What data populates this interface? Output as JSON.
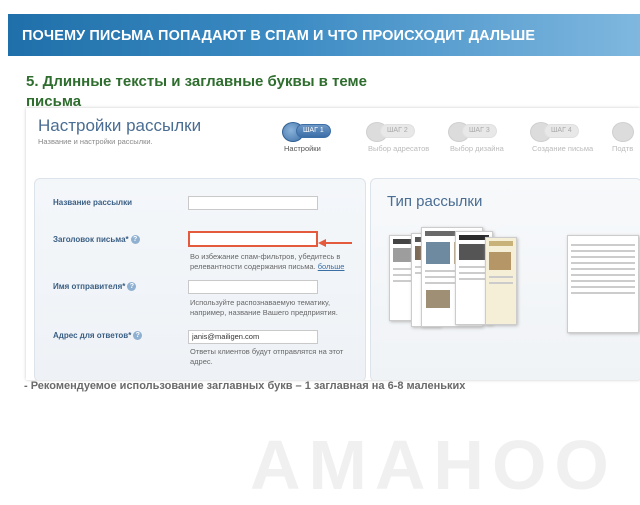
{
  "slide": {
    "header_title": "ПОЧЕМУ ПИСЬМА ПОПАДАЮТ В СПАМ И ЧТО ПРОИСХОДИТ ДАЛЬШЕ",
    "subtitle": "5. Длинные тексты и заглавные буквы в теме письма",
    "footnote": "- Рекомендуемое использование заглавных букв – 1 заглавная на 6-8 маленьких",
    "watermark": "AMAHOO",
    "colors": {
      "header_start": "#1f6faa",
      "header_end": "#7fb7df",
      "subtitle": "#2e6d2e",
      "highlight": "#e45a3c"
    }
  },
  "screenshot": {
    "title": "Настройки рассылки",
    "subtitle": "Название и настройки рассылки.",
    "steps": [
      {
        "pill": "ШАГ 1",
        "label": "Настройки",
        "active": true,
        "icon": "settings-icon"
      },
      {
        "pill": "ШАГ 2",
        "label": "Выбор адресатов",
        "active": false,
        "icon": "people-icon"
      },
      {
        "pill": "ШАГ 3",
        "label": "Выбор дизайна",
        "active": false,
        "icon": "design-icon"
      },
      {
        "pill": "ШАГ 4",
        "label": "Создание письма",
        "active": false,
        "icon": "edit-icon"
      },
      {
        "pill": "",
        "label": "Подтв",
        "active": false,
        "icon": "confirm-icon"
      }
    ],
    "form": {
      "name_label": "Название рассылки",
      "name_value": "",
      "subject_label": "Заголовок письма*",
      "subject_value": "",
      "subject_hint": "Во избежание спам-фильтров, убедитесь в релевантности содержания письма.",
      "subject_hint_link": "больше",
      "sender_label": "Имя отправителя*",
      "sender_value": "",
      "sender_hint": "Используйте распознаваемую тематику, например, название Вашего предприятия.",
      "reply_label": "Адрес для ответов*",
      "reply_value": "janis@mailigen.com",
      "reply_hint": "Ответы клиентов будут отправлятся на этот адрес."
    },
    "type_panel": {
      "title": "Тип рассылки"
    }
  }
}
